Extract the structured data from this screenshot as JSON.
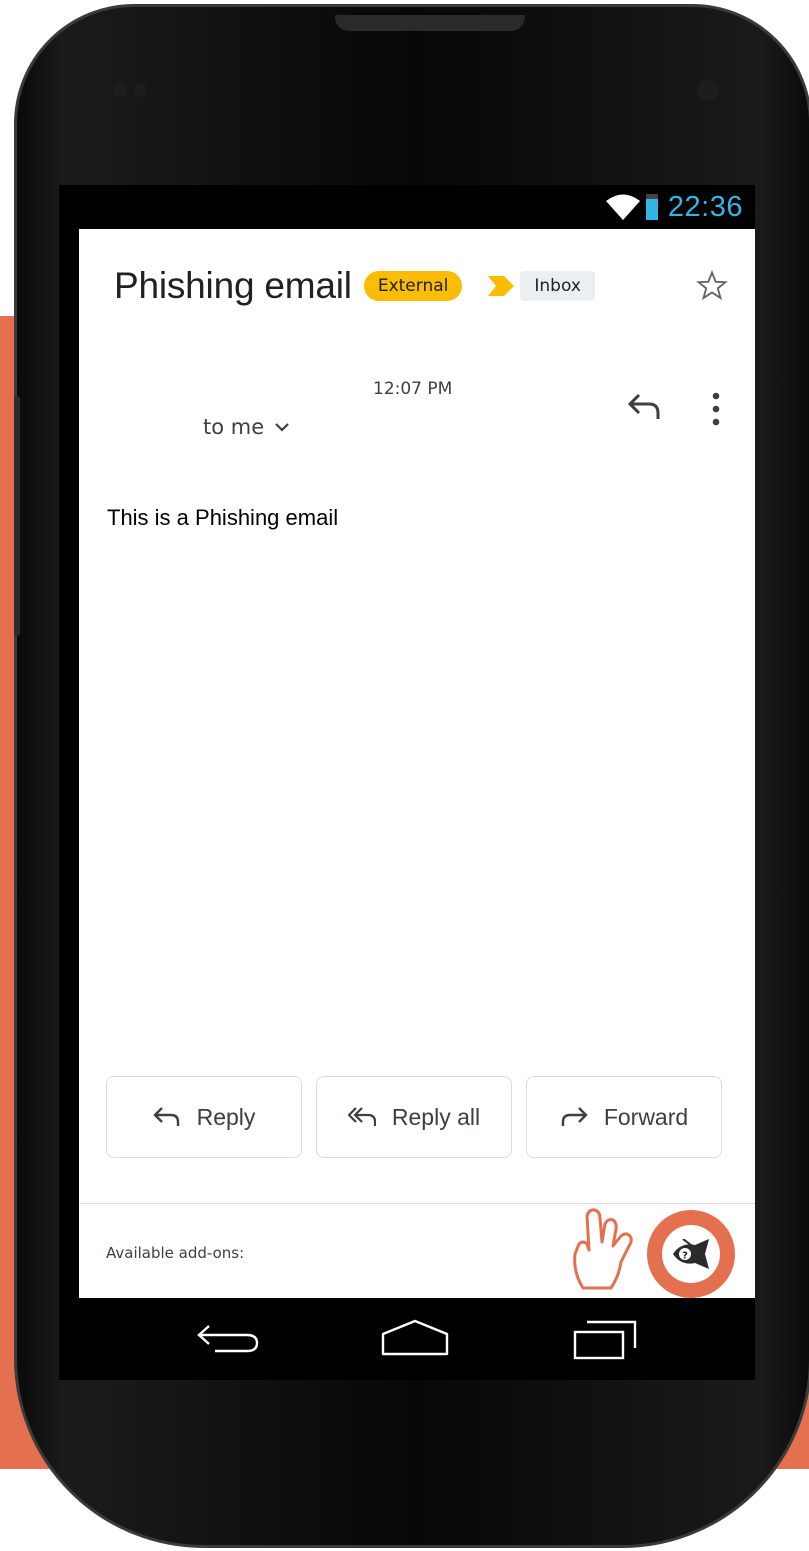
{
  "status_bar": {
    "time": "22:36",
    "wifi_icon": "wifi-icon",
    "battery_icon": "battery-icon",
    "accent_color": "#33b5e5"
  },
  "email": {
    "subject": "Phishing email",
    "badges": {
      "external": "External",
      "inbox": "Inbox"
    },
    "time": "12:07 PM",
    "recipient": "to me",
    "body": "This is a Phishing email"
  },
  "actions": [
    {
      "label": "Reply",
      "icon": "reply-icon"
    },
    {
      "label": "Reply all",
      "icon": "reply-all-icon"
    },
    {
      "label": "Forward",
      "icon": "forward-icon"
    }
  ],
  "addons": {
    "label": "Available add-ons:",
    "addon_icon": "phishing-fish-icon",
    "brand_color": "#e4704f"
  },
  "nav": {
    "back": "back-icon",
    "home": "home-icon",
    "recents": "recents-icon"
  }
}
